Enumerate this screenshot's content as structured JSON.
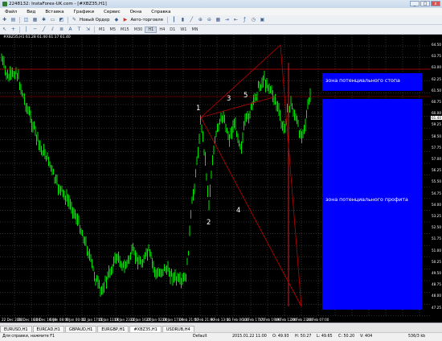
{
  "window": {
    "title": "2248132: InstaForex-UK.com - [#XBZ35,H1]",
    "minimize_label": "_",
    "maximize_label": "□",
    "close_label": "x"
  },
  "menu": [
    "Файл",
    "Вид",
    "Вставка",
    "Графики",
    "Сервис",
    "Окна",
    "Справка"
  ],
  "toolbar": {
    "new_order_label": "Новый Ордер",
    "autotrading_label": "Авто-торговля",
    "timeframes": [
      "M1",
      "M5",
      "M15",
      "M30",
      "H1",
      "H4",
      "D1",
      "W1",
      "MN"
    ],
    "active_timeframe": "H1"
  },
  "chart": {
    "symbol_info": "#XBZ35,H1  61.28 61.40 61.17 61.40",
    "price_labels": [
      "64.50",
      "63.75",
      "63.00",
      "62.25",
      "61.50",
      "60.75",
      "60.00",
      "59.25",
      "58.50",
      "57.75",
      "57.00",
      "56.25",
      "55.50",
      "54.75",
      "54.00",
      "53.25",
      "52.50",
      "51.75",
      "51.00",
      "50.25",
      "49.50",
      "48.75",
      "48.00",
      "47.25"
    ],
    "current_price": "61.40",
    "time_labels": [
      "22 Dec 2014",
      "26 Dec 16:00",
      "31 Dec 16:00",
      "6 Jan 08:00",
      "9 Jan 00:00",
      "12 Jan 17:00",
      "15 Jan 11:00",
      "19 Jan 23:00",
      "22 Jan 16:00",
      "27 Jan 02:00",
      "29 Jan 17:00",
      "3 Feb 21:00",
      "5 Feb 21:00",
      "9 Feb 13:00",
      "11 Feb 06:00",
      "13 Feb 17:00",
      "17 Feb 19:00",
      "19 Feb 12:00",
      "20 Feb 23:00",
      "24 Feb 07:00"
    ],
    "candle_color": "#00ff00",
    "zones": {
      "stop": "зона потенциального стопа",
      "profit": "зона потенциального профита",
      "color": "#0000ff"
    },
    "wave_labels": [
      "1",
      "2",
      "3",
      "4",
      "5"
    ]
  },
  "tabs": [
    "EURUSD,H1",
    "EURCAD,H1",
    "GBPAUD,H1",
    "EURGBP,H1",
    "#XBZ35,H1",
    "USDRUB,H4"
  ],
  "active_tab": "#XBZ35,H1",
  "status": {
    "help": "Для справки, нажмите F1",
    "profile": "Default",
    "datetime": "2015.01.22 11:00",
    "open": "O: 49.93",
    "high": "H: 50.27",
    "low": "L: 49.65",
    "close": "C: 50.20",
    "volume": "V: 404",
    "traffic": "536/3 kb"
  }
}
